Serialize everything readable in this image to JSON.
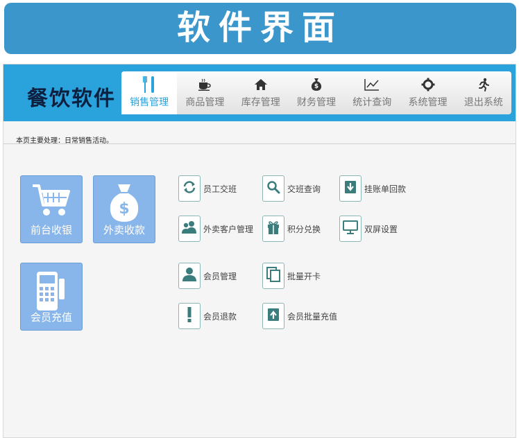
{
  "banner": {
    "title": "软件界面"
  },
  "app": {
    "name": "餐饮软件"
  },
  "nav": {
    "items": [
      {
        "label": "销售管理",
        "icon": "utensils-icon"
      },
      {
        "label": "商品管理",
        "icon": "coffee-cup-icon"
      },
      {
        "label": "库存管理",
        "icon": "home-icon"
      },
      {
        "label": "财务管理",
        "icon": "money-bag-icon"
      },
      {
        "label": "统计查询",
        "icon": "line-chart-icon"
      },
      {
        "label": "系统管理",
        "icon": "gear-icon"
      },
      {
        "label": "退出系统",
        "icon": "running-man-icon"
      }
    ]
  },
  "info": {
    "text": "本页主要处理：日常销售活动。"
  },
  "tiles": {
    "front_cashier": "前台收银",
    "takeout": "外卖收款",
    "member_recharge": "会员充值"
  },
  "functions": {
    "shift_handover": "员工交班",
    "shift_query": "交班查询",
    "credit_repayment": "挂账单回款",
    "takeout_customer": "外卖客户管理",
    "points_exchange": "积分兑换",
    "dual_screen": "双屏设置",
    "member_manage": "会员管理",
    "batch_card": "批量开卡",
    "member_refund": "会员退款",
    "member_batch_recharge": "会员批量充值"
  },
  "colors": {
    "banner": "#3b96cc",
    "header": "#2aa3dd",
    "tile": "#88b6ea",
    "icon_teal": "#3b7d7d"
  }
}
